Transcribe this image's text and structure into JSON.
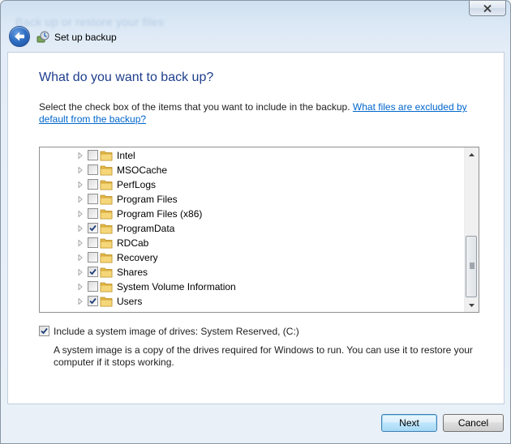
{
  "window": {
    "blurred_title": "Back up or restore your files",
    "close_label": "✕"
  },
  "header": {
    "title": "Set up backup"
  },
  "main": {
    "heading": "What do you want to back up?",
    "instructions": "Select the check box of the items that you want to include in the backup. ",
    "excluded_link": "What files are excluded by default from the backup?",
    "tree_items": [
      {
        "label": "Intel",
        "checked": false
      },
      {
        "label": "MSOCache",
        "checked": false
      },
      {
        "label": "PerfLogs",
        "checked": false
      },
      {
        "label": "Program Files",
        "checked": false
      },
      {
        "label": "Program Files (x86)",
        "checked": false
      },
      {
        "label": "ProgramData",
        "checked": true
      },
      {
        "label": "RDCab",
        "checked": false
      },
      {
        "label": "Recovery",
        "checked": false
      },
      {
        "label": "Shares",
        "checked": true
      },
      {
        "label": "System Volume Information",
        "checked": false
      },
      {
        "label": "Users",
        "checked": true
      }
    ],
    "system_image": {
      "checked": true,
      "label": "Include a system image of drives: System Reserved, (C:)",
      "description": "A system image is a copy of the drives required for Windows to run. You can use it to restore your computer if it stops working."
    }
  },
  "footer": {
    "next_label": "Next",
    "cancel_label": "Cancel"
  },
  "icons": {
    "back": "back-arrow-icon",
    "app": "backup-icon",
    "folder": "folder-icon",
    "expander": "triangle-right-icon"
  }
}
